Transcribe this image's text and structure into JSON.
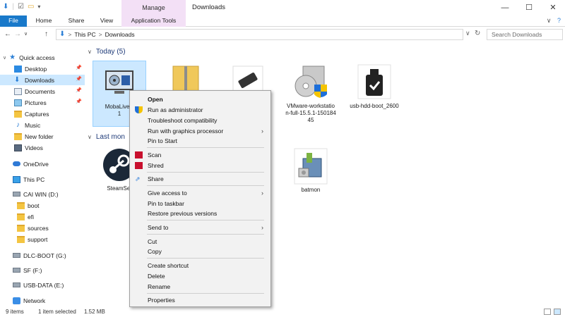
{
  "window": {
    "title": "Downloads",
    "minimize": "—",
    "maximize": "☐",
    "close": "✕"
  },
  "ribbon": {
    "context_group": "Manage",
    "tabs": {
      "file": "File",
      "home": "Home",
      "share": "Share",
      "view": "View",
      "app_tools": "Application Tools"
    },
    "expand": "∨",
    "help": "?"
  },
  "address": {
    "path": [
      "This PC",
      "Downloads"
    ],
    "separator": ">",
    "search_placeholder": "Search Downloads"
  },
  "sidebar": {
    "quick_access": "Quick access",
    "items": [
      {
        "label": "Desktop",
        "icon": "desktop-icon",
        "pinned": true
      },
      {
        "label": "Downloads",
        "icon": "downloads-icon",
        "pinned": true,
        "selected": true
      },
      {
        "label": "Documents",
        "icon": "documents-icon",
        "pinned": true
      },
      {
        "label": "Pictures",
        "icon": "pictures-icon",
        "pinned": true
      },
      {
        "label": "Captures",
        "icon": "folder-icon"
      },
      {
        "label": "Music",
        "icon": "music-icon"
      },
      {
        "label": "New folder",
        "icon": "folder-icon"
      },
      {
        "label": "Videos",
        "icon": "videos-icon"
      }
    ],
    "onedrive": "OneDrive",
    "this_pc": "This PC",
    "drive_d": "CAI WIN (D:)",
    "drive_d_folders": [
      "boot",
      "efi",
      "sources",
      "support"
    ],
    "drive_g": "DLC-BOOT (G:)",
    "drive_f": "SF (F:)",
    "drive_e": "USB-DATA (E:)",
    "network": "Network",
    "pin_glyph": "📌"
  },
  "main": {
    "group_today": "Today (5)",
    "group_last_month": "Last mon",
    "today_files": [
      {
        "name": "MobaLiveC\n1",
        "icon": "moba-icon",
        "selected": true
      },
      {
        "name": "",
        "icon": "zip-folder-icon"
      },
      {
        "name": "",
        "icon": "usb-tool-icon"
      },
      {
        "name": "VMware-workstation-full-15.5.1-15018445",
        "icon": "vmware-installer-icon"
      },
      {
        "name": "usb-hdd-boot_2600",
        "icon": "usb-drive-icon"
      }
    ],
    "last_month_files": [
      {
        "name": "SteamSet",
        "icon": "steam-icon"
      },
      {
        "name": "batmon",
        "icon": "installer-icon"
      }
    ]
  },
  "context_menu": {
    "items": [
      {
        "label": "Open",
        "bold": true
      },
      {
        "label": "Run as administrator",
        "icon": "uac-shield-icon"
      },
      {
        "label": "Troubleshoot compatibility"
      },
      {
        "label": "Run with graphics processor",
        "submenu": true
      },
      {
        "label": "Pin to Start"
      },
      {
        "label": "Scan",
        "icon": "mcafee-icon"
      },
      {
        "label": "Shred",
        "icon": "mcafee-icon"
      },
      {
        "label": "Share",
        "icon": "share-icon"
      },
      {
        "label": "Give access to",
        "submenu": true
      },
      {
        "label": "Pin to taskbar"
      },
      {
        "label": "Restore previous versions"
      },
      {
        "label": "Send to",
        "submenu": true
      },
      {
        "label": "Cut"
      },
      {
        "label": "Copy"
      },
      {
        "label": "Create shortcut"
      },
      {
        "label": "Delete"
      },
      {
        "label": "Rename"
      },
      {
        "label": "Properties"
      }
    ]
  },
  "status": {
    "item_count": "9 items",
    "selection": "1 item selected",
    "size": "1.52 MB"
  },
  "colors": {
    "accent": "#1979ca",
    "selection": "#cce8ff",
    "manage_tab": "#f3e0f6",
    "group_title": "#1e3a78"
  }
}
